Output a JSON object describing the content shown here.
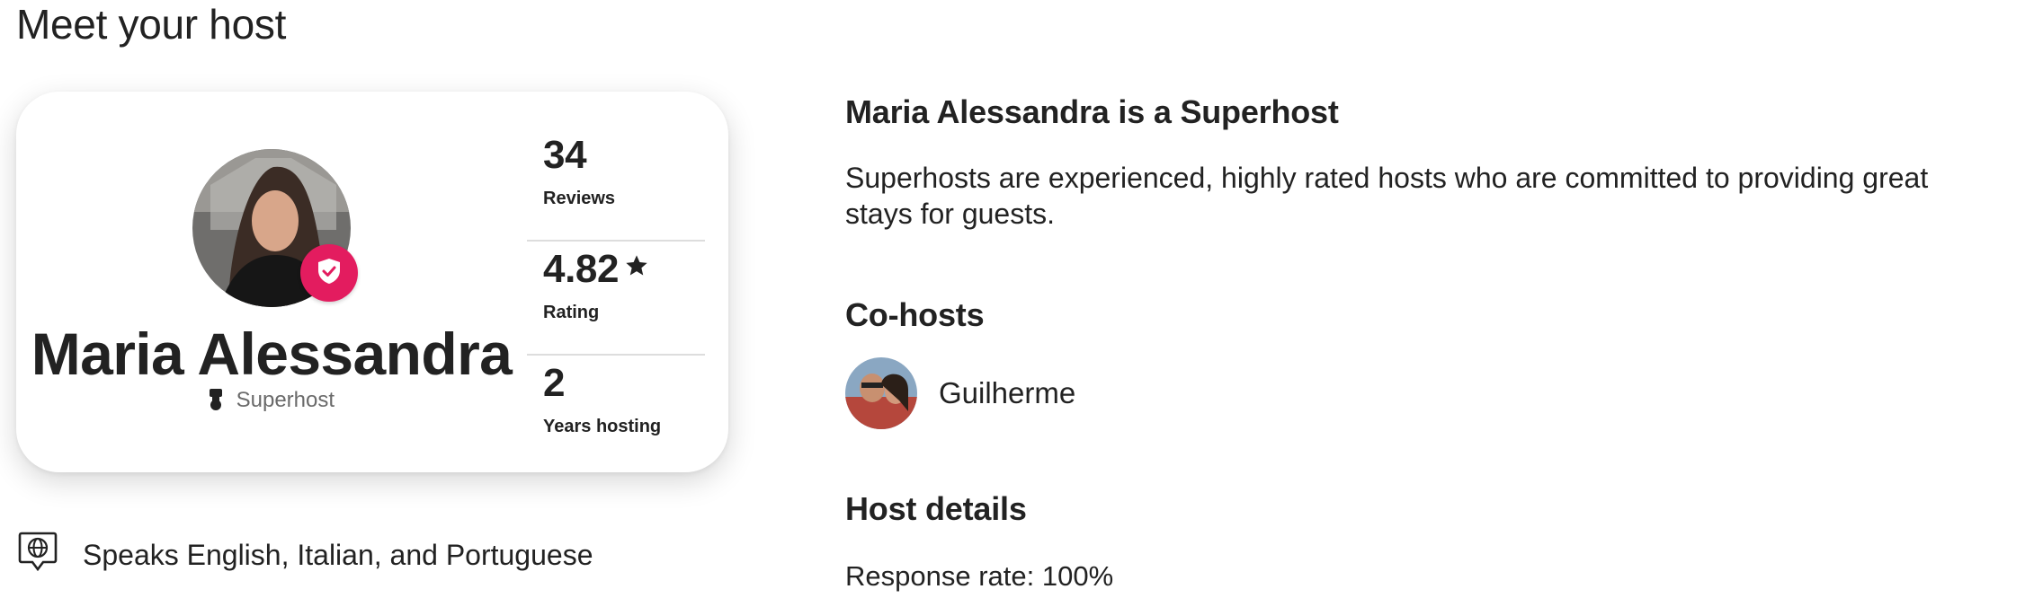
{
  "section_title": "Meet your host",
  "host": {
    "name": "Maria Alessandra",
    "role": "Superhost",
    "stats": [
      {
        "value": "34",
        "label": "Reviews"
      },
      {
        "value": "4.82",
        "label": "Rating",
        "icon": "star-icon"
      },
      {
        "value": "2",
        "label": "Years hosting"
      }
    ],
    "badge_icon": "shield-check-icon",
    "badge_color": "#e31c5f"
  },
  "languages": "Speaks English, Italian, and Portuguese",
  "superhost": {
    "heading": "Maria Alessandra is a Superhost",
    "description": "Superhosts are experienced, highly rated hosts who are committed to providing great stays for guests."
  },
  "cohosts": {
    "heading": "Co-hosts",
    "items": [
      {
        "name": "Guilherme"
      }
    ]
  },
  "host_details": {
    "heading": "Host details",
    "response_rate": "Response rate: 100%"
  }
}
